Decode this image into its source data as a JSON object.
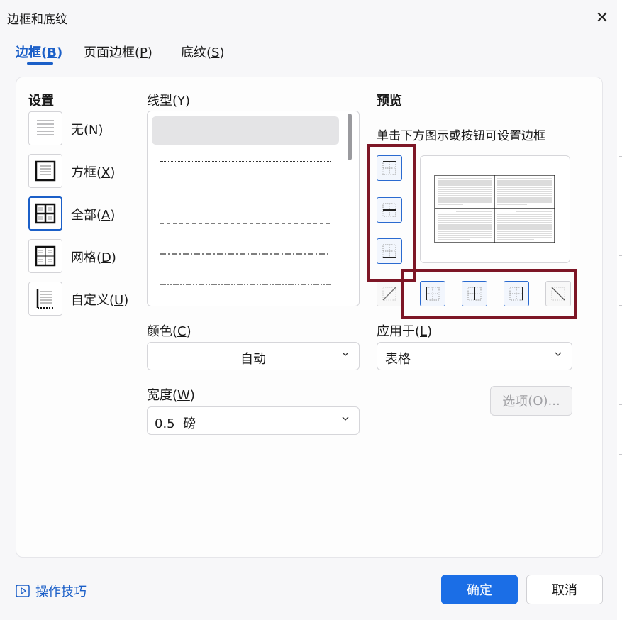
{
  "dialog": {
    "title": "边框和底纹"
  },
  "tabs": [
    {
      "label": "边框",
      "key": "B"
    },
    {
      "label": "页面边框",
      "key": "P"
    },
    {
      "label": "底纹",
      "key": "S"
    }
  ],
  "settings": {
    "heading": "设置",
    "items": [
      {
        "label": "无",
        "key": "N"
      },
      {
        "label": "方框",
        "key": "X"
      },
      {
        "label": "全部",
        "key": "A"
      },
      {
        "label": "网格",
        "key": "D"
      },
      {
        "label": "自定义",
        "key": "U"
      }
    ]
  },
  "line_style": {
    "label": "线型",
    "key": "Y"
  },
  "color": {
    "label": "颜色",
    "key": "C",
    "value": "自动"
  },
  "width": {
    "label": "宽度",
    "key": "W",
    "value": "0.5  磅"
  },
  "preview": {
    "heading": "预览",
    "hint": "单击下方图示或按钮可设置边框"
  },
  "apply_to": {
    "label": "应用于",
    "key": "L",
    "value": "表格"
  },
  "options_button": {
    "label": "选项",
    "key": "O",
    "suffix": "..."
  },
  "footer": {
    "tips": "操作技巧",
    "ok": "确定",
    "cancel": "取消"
  },
  "colors": {
    "accent": "#1b6ee6",
    "highlight": "#7d1626"
  }
}
